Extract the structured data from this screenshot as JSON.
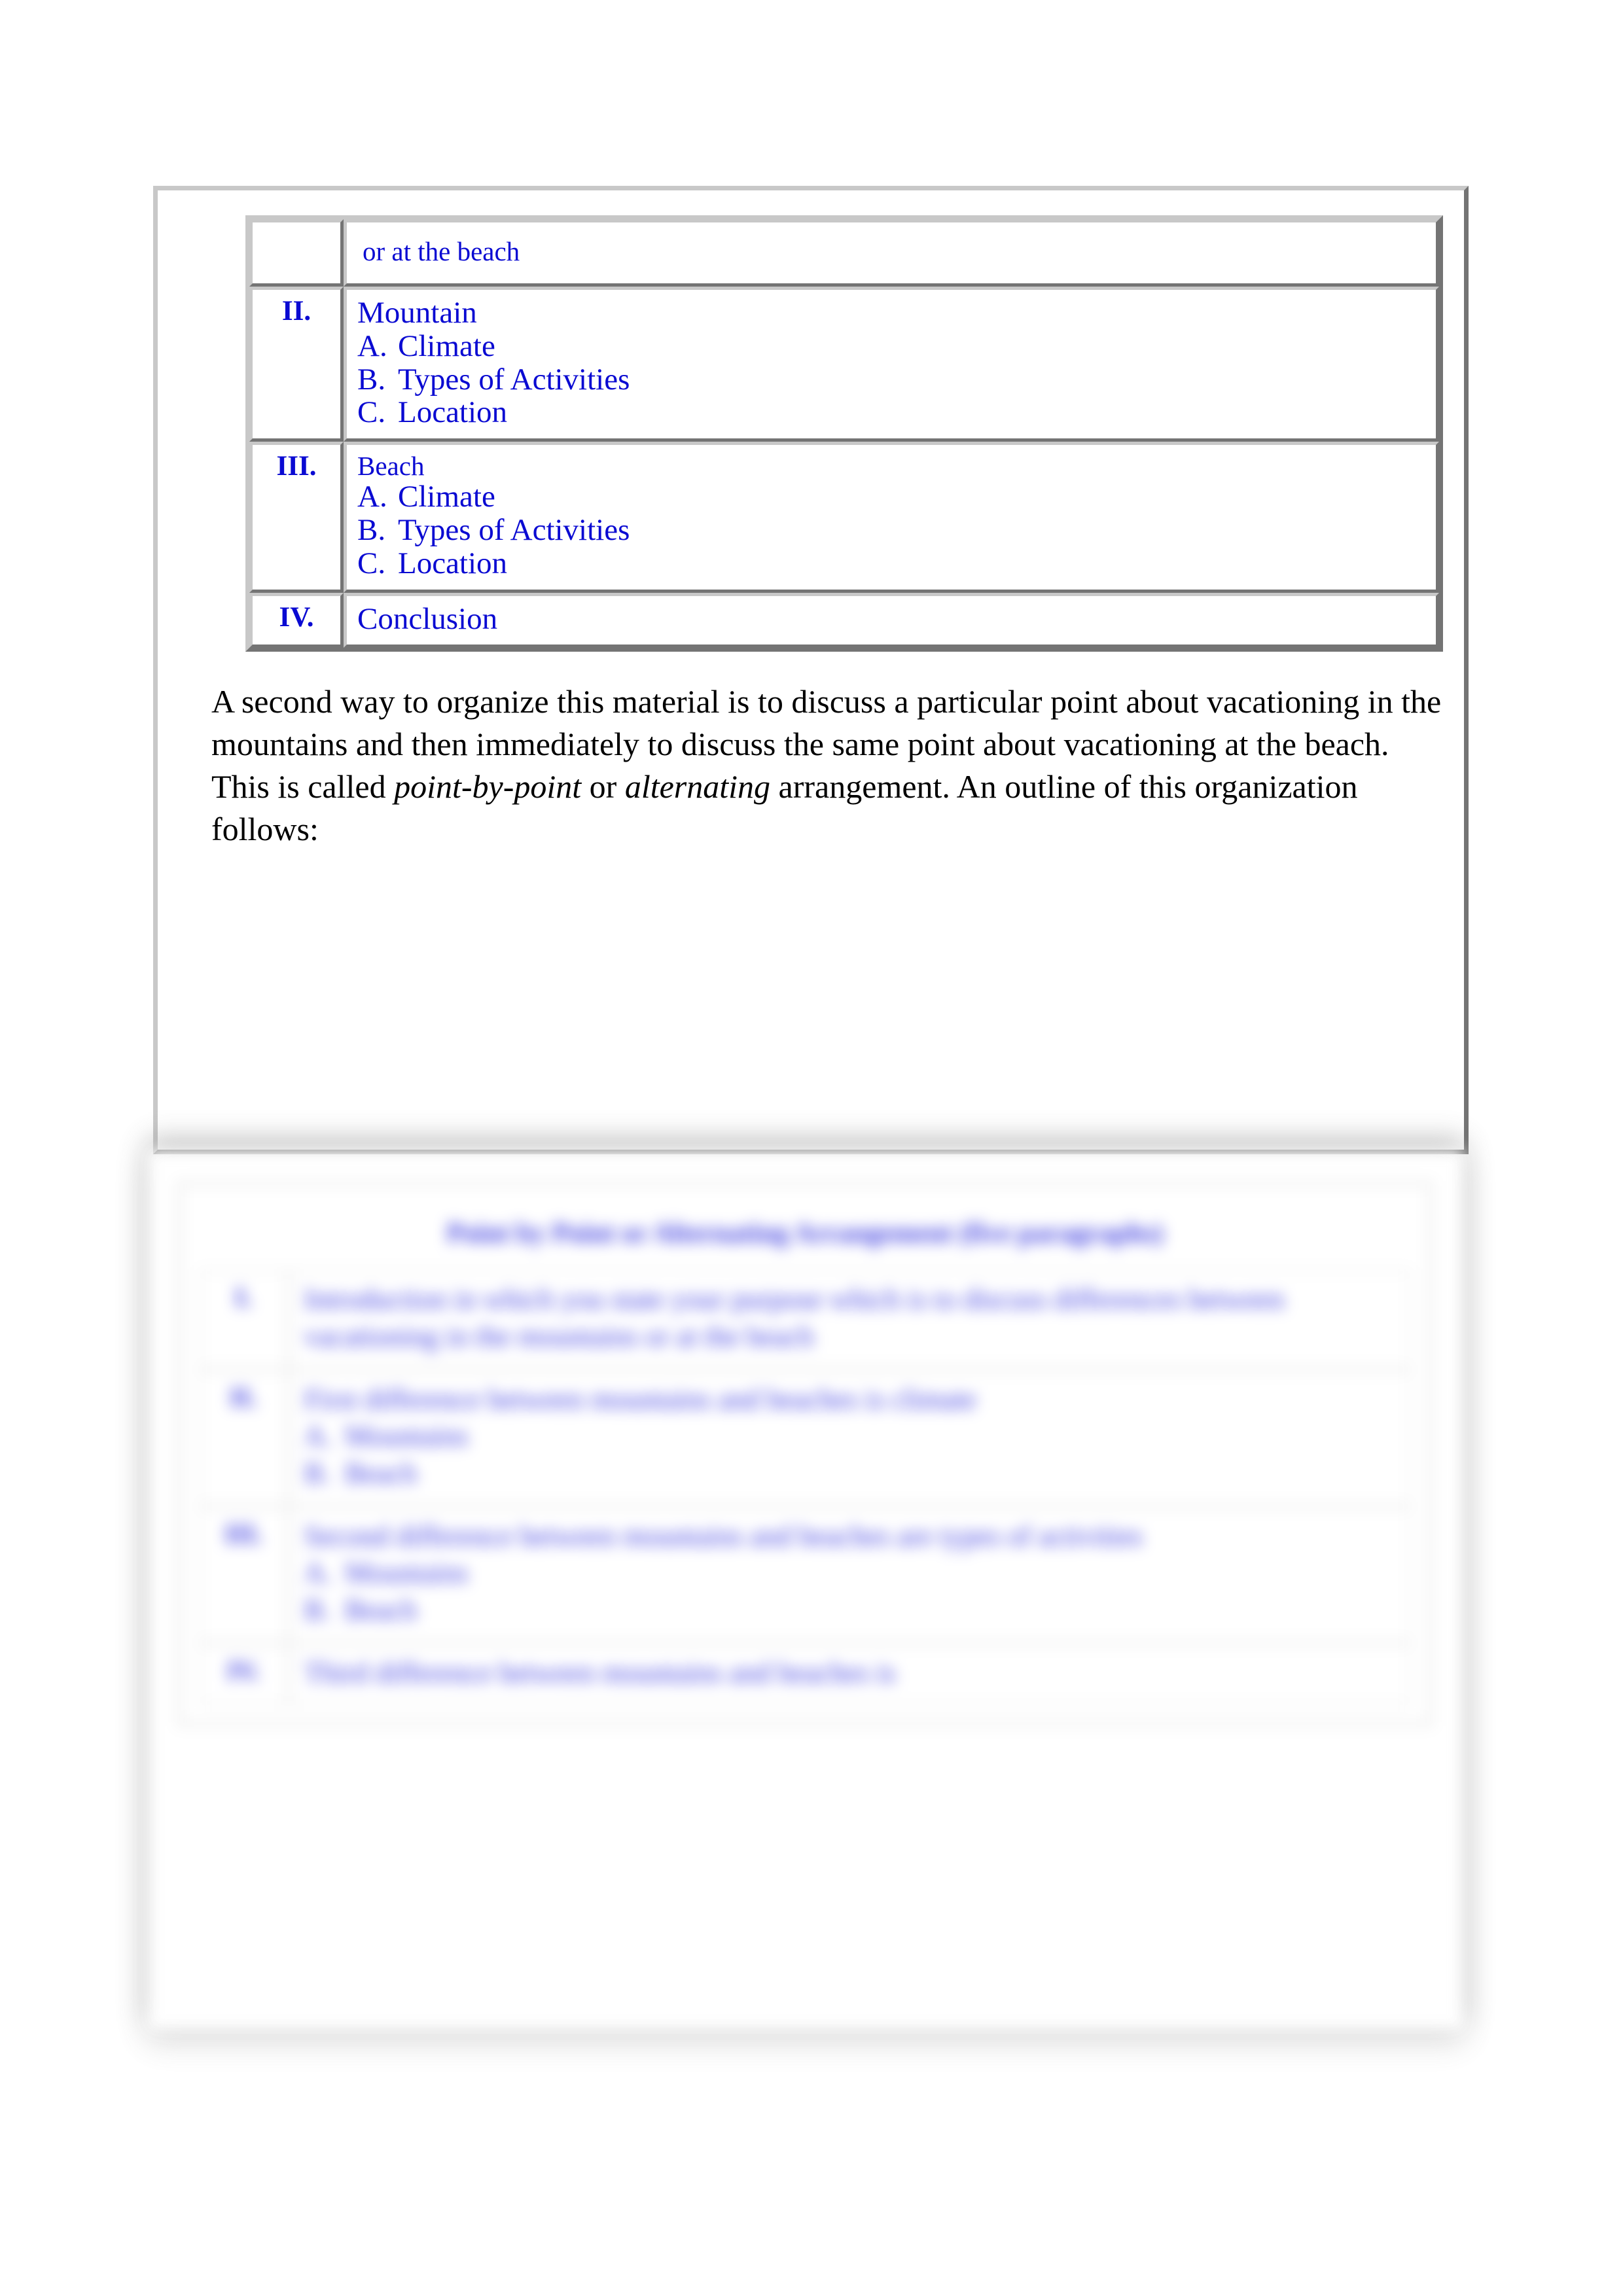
{
  "colors": {
    "outline_text": "#0a0ad2",
    "body_text": "#000000",
    "border": "#c8c8c8",
    "blur_text": "#3a3ae0"
  },
  "outline_table": {
    "rows": [
      {
        "numeral": "",
        "heading": "or at the beach",
        "heading_size": "small",
        "sub_items": []
      },
      {
        "numeral": "II.",
        "heading": "Mountain",
        "heading_size": "large",
        "sub_items": [
          {
            "letter": "A.",
            "text": "Climate"
          },
          {
            "letter": "B.",
            "text": "Types of Activities"
          },
          {
            "letter": "C.",
            "text": "Location"
          }
        ]
      },
      {
        "numeral": "III.",
        "heading": "Beach",
        "heading_size": "small",
        "sub_items": [
          {
            "letter": "A.",
            "text": "Climate"
          },
          {
            "letter": "B.",
            "text": "Types of Activities"
          },
          {
            "letter": "C.",
            "text": "Location"
          }
        ]
      },
      {
        "numeral": "IV.",
        "heading": "Conclusion",
        "heading_size": "large",
        "sub_items": []
      }
    ]
  },
  "paragraph": {
    "part1": "A second way to organize this material is to discuss a particular point about vacationing in the mountains and then immediately to discuss the same point about vacationing at the beach.  This is called ",
    "emphasis1": "point-by-point",
    "part2": " or ",
    "emphasis2": "alternating",
    "part3": " arrangement.  An outline of this organization follows:"
  },
  "blurred_section": {
    "title": "Point by Point or Alternating Arrangement (five paragraphs)",
    "rows": [
      {
        "numeral": "I.",
        "heading": "Introduction in which you state your purpose which is to discuss differences between vacationing in the mountains or at the beach",
        "sub_items": []
      },
      {
        "numeral": "II.",
        "heading": "First difference between mountains and beaches is climate",
        "sub_items": [
          {
            "letter": "A.",
            "text": "Mountains"
          },
          {
            "letter": "B.",
            "text": "Beach"
          }
        ]
      },
      {
        "numeral": "III.",
        "heading": "Second difference between mountains and beaches are types of activities",
        "sub_items": [
          {
            "letter": "A.",
            "text": "Mountains"
          },
          {
            "letter": "B.",
            "text": "Beach"
          }
        ]
      },
      {
        "numeral": "IV.",
        "heading": "Third difference between mountains and beaches is",
        "sub_items": []
      }
    ]
  }
}
